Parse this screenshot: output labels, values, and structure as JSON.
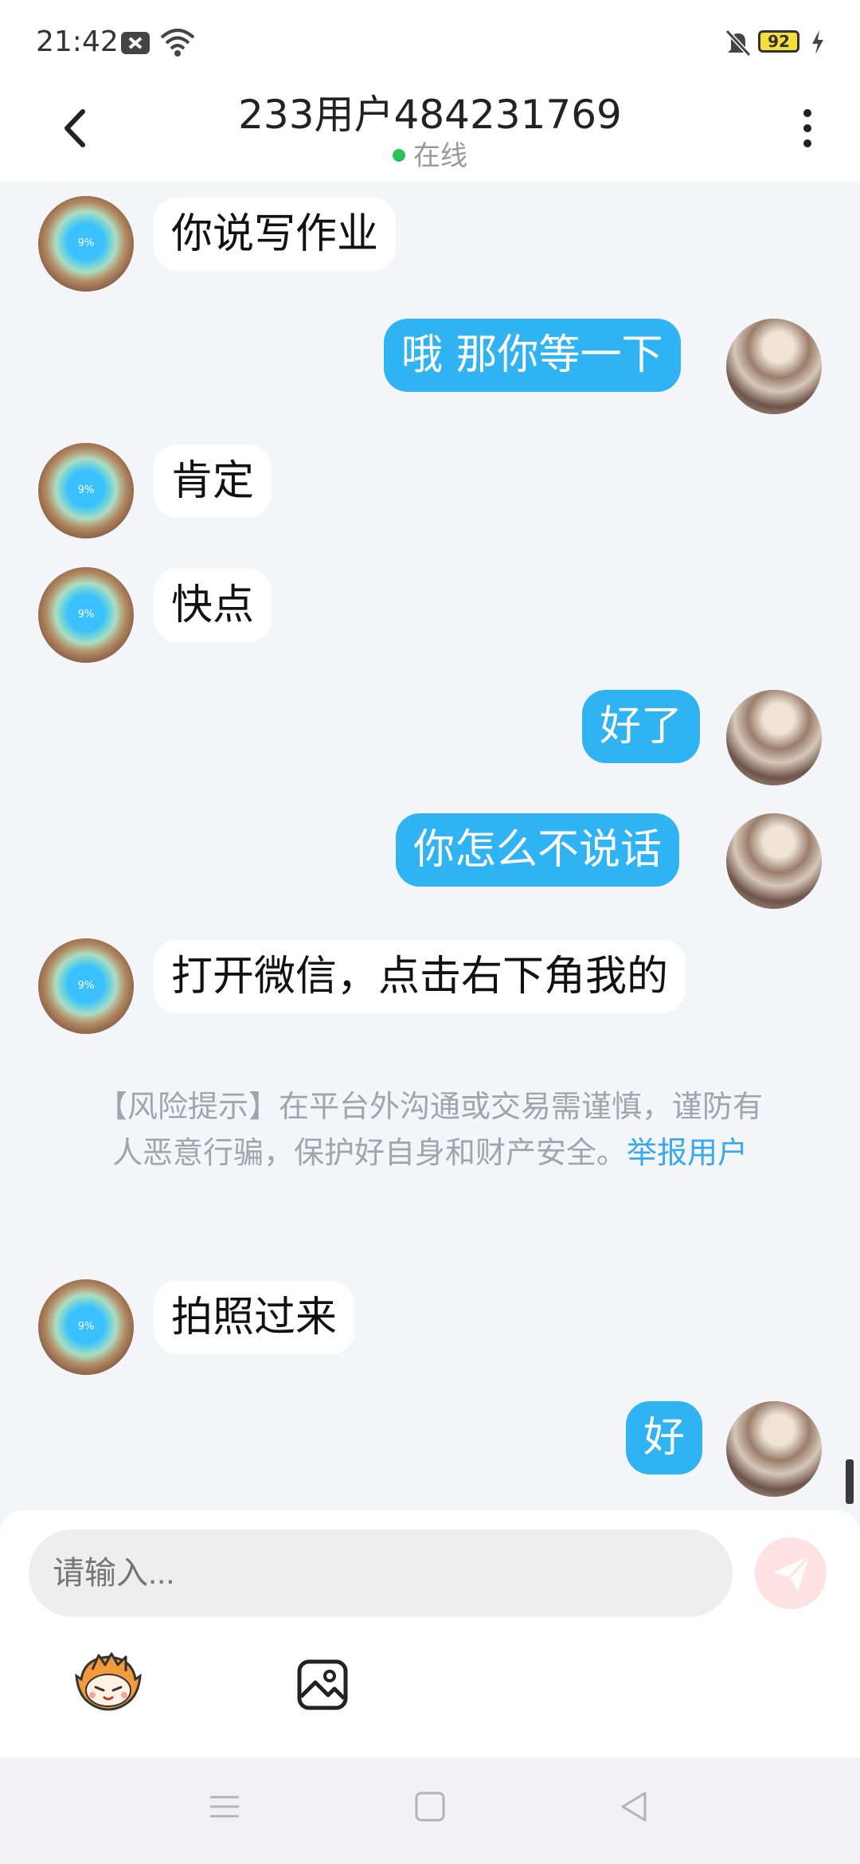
{
  "status_bar": {
    "time": "21:42",
    "battery": "92",
    "icons": [
      "notification-close-icon",
      "wifi-icon",
      "mute-icon",
      "battery-icon",
      "charging-icon"
    ]
  },
  "header": {
    "title": "233用户484231769",
    "status": "在线"
  },
  "messages": [
    {
      "sender": "peer",
      "text": "你说写作业"
    },
    {
      "sender": "me",
      "text": "哦 那你等一下"
    },
    {
      "sender": "peer",
      "text": "肯定"
    },
    {
      "sender": "peer",
      "text": "快点"
    },
    {
      "sender": "me",
      "text": "好了"
    },
    {
      "sender": "me",
      "text": "你怎么不说话"
    },
    {
      "sender": "peer",
      "text": "打开微信，点击右下角我的"
    },
    {
      "sender": "peer",
      "text": "拍照过来"
    },
    {
      "sender": "me",
      "text": "好"
    }
  ],
  "peer_avatar_label": "9%",
  "risk_notice": {
    "text": "【风险提示】在平台外沟通或交易需谨慎，谨防有人恶意行骗，保护好自身和财产安全。",
    "link": "举报用户"
  },
  "input": {
    "placeholder": "请输入..."
  },
  "colors": {
    "my_bubble": "#2fb3f2",
    "peer_bubble": "#ffffff",
    "background": "#f4f5f9",
    "online_dot": "#2ac35a",
    "link": "#38a9ec",
    "send_button": "#fde1e3"
  }
}
